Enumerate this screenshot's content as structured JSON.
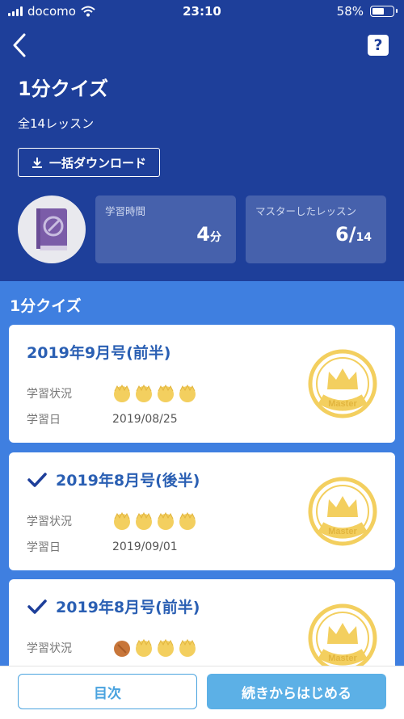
{
  "status": {
    "carrier": "docomo",
    "time": "23:10",
    "battery": "58%",
    "battery_level": 0.58
  },
  "header": {
    "title": "1分クイズ",
    "subtitle": "全14レッスン",
    "download_label": "一括ダウンロード",
    "help_label": "?"
  },
  "stats": {
    "study_time_label": "学習時間",
    "study_time_value": "4",
    "study_time_unit": "分",
    "mastered_label": "マスターしたレッスン",
    "mastered_value": "6/",
    "mastered_total": "14"
  },
  "section": {
    "title": "1分クイズ"
  },
  "lessons": [
    {
      "title": "2019年9月号(前半)",
      "checked": false,
      "status_label": "学習状況",
      "date_label": "学習日",
      "date": "2019/08/25",
      "medals": [
        "gold",
        "gold",
        "gold",
        "gold"
      ],
      "badge_text": "Master"
    },
    {
      "title": "2019年8月号(後半)",
      "checked": true,
      "status_label": "学習状況",
      "date_label": "学習日",
      "date": "2019/09/01",
      "medals": [
        "gold",
        "gold",
        "gold",
        "gold"
      ],
      "badge_text": "Master"
    },
    {
      "title": "2019年8月号(前半)",
      "checked": true,
      "status_label": "学習状況",
      "medals": [
        "bronze",
        "gold",
        "gold",
        "gold"
      ],
      "badge_text": "Master"
    }
  ],
  "bottom": {
    "toc_label": "目次",
    "continue_label": "続きからはじめる"
  },
  "colors": {
    "header_bg": "#1e3f9a",
    "page_bg": "#3f7fe0",
    "title_blue": "#2a5fb3",
    "gold": "#f3cf5f",
    "bronze": "#c8763a",
    "accent": "#5cb0e6"
  }
}
